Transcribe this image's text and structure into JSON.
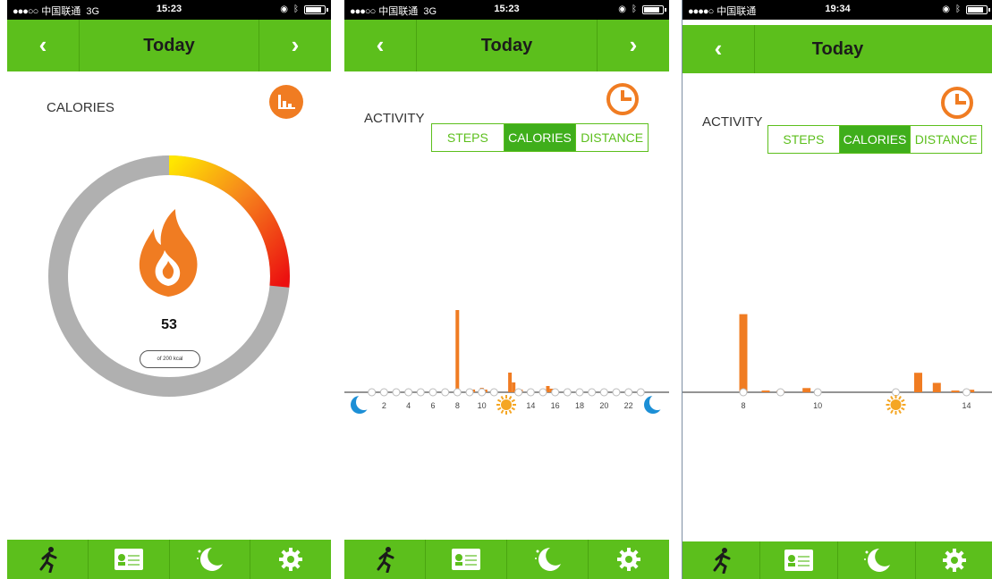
{
  "status_bar": {
    "screen1": {
      "carrier": "中国联通",
      "network": "3G",
      "time": "15:23"
    },
    "screen2": {
      "carrier": "中国联通",
      "network": "3G",
      "time": "15:23"
    },
    "screen3": {
      "carrier": "中国联通",
      "network": "",
      "time": "19:34"
    }
  },
  "navbar": {
    "title": "Today",
    "prev": "‹",
    "next": "›"
  },
  "screen1": {
    "label": "CALORIES",
    "value": "53",
    "pill_text": "of 200 kcal",
    "ring_progress": 0.265,
    "icon": "bar-chart-icon"
  },
  "activity": {
    "label": "ACTIVITY",
    "tabs": [
      "STEPS",
      "CALORIES",
      "DISTANCE"
    ],
    "active_tab": "CALORIES",
    "toggle_icon": "clock-icon"
  },
  "chart_data": [
    {
      "type": "bar",
      "title": "",
      "x": [
        8,
        9.3,
        10,
        10.3,
        12.3,
        12.6,
        13.2,
        15.4,
        15.7
      ],
      "values": [
        92,
        3,
        5,
        3,
        22,
        11,
        3,
        7,
        4
      ],
      "x_ticks": [
        2,
        4,
        6,
        8,
        10,
        12,
        14,
        16,
        18,
        20,
        22
      ],
      "x_tick_labels": [
        "2",
        "4",
        "6",
        "8",
        "10",
        "12",
        "14",
        "16",
        "18",
        "20",
        "22"
      ],
      "xlim": [
        0,
        24
      ],
      "ylim": [
        0,
        100
      ],
      "grid": false,
      "color": "#f07c22"
    },
    {
      "type": "bar",
      "title": "",
      "x": [
        8,
        8.6,
        9.0,
        9.7,
        12.7,
        13.2,
        13.7,
        14.1
      ],
      "values": [
        92,
        2,
        2,
        5,
        23,
        11,
        2,
        3
      ],
      "x_ticks": [
        8,
        10,
        14
      ],
      "x_tick_labels": [
        "8",
        "10",
        "14"
      ],
      "xlim": [
        8,
        14.3
      ],
      "ylim": [
        0,
        100
      ],
      "grid": false,
      "color": "#f07c22"
    }
  ],
  "colors": {
    "green": "#5cbf1c",
    "green_dark": "#3fae1b",
    "orange": "#f07c22",
    "ring_gray": "#b0b0b0",
    "moon_blue": "#1c8fd6"
  },
  "tabbar": {
    "icons": [
      "running-man-icon",
      "id-card-icon",
      "moon-icon",
      "gear-icon"
    ]
  }
}
